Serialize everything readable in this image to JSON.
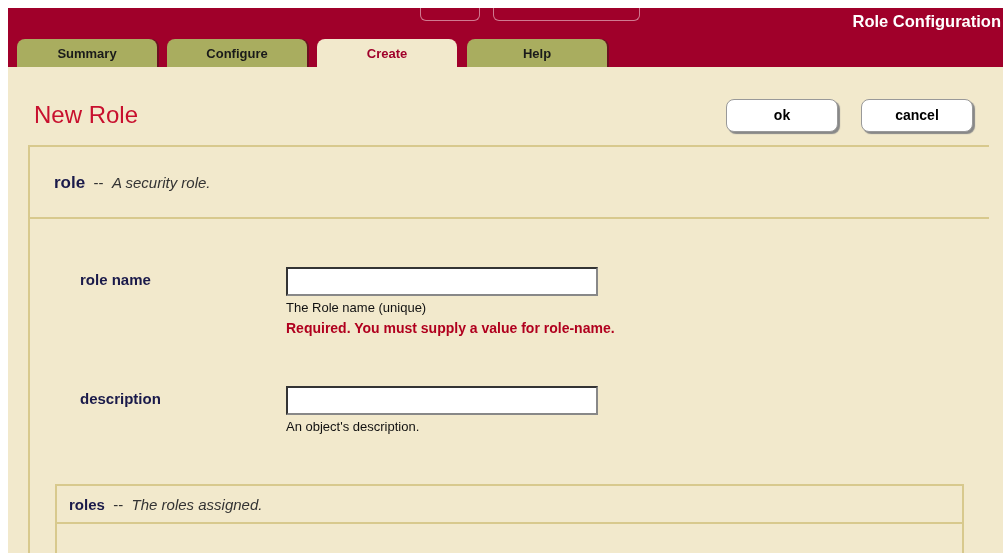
{
  "header": {
    "title": "Role Configuration"
  },
  "tabs": [
    {
      "label": "Summary",
      "selected": false
    },
    {
      "label": "Configure",
      "selected": false
    },
    {
      "label": "Create",
      "selected": true
    },
    {
      "label": "Help",
      "selected": false
    }
  ],
  "page_title": "New Role",
  "buttons": [
    "ok",
    "cancel"
  ],
  "section": {
    "name": "role",
    "separator": "--",
    "description": "A security role."
  },
  "fields": [
    {
      "label": "role name",
      "hint": "The Role name (unique)",
      "error": "Required. You must supply a value for role-name."
    },
    {
      "label": "description",
      "hint": "An object's description."
    }
  ],
  "subsection": {
    "name": "roles",
    "separator": "--",
    "description": "The roles assigned."
  }
}
